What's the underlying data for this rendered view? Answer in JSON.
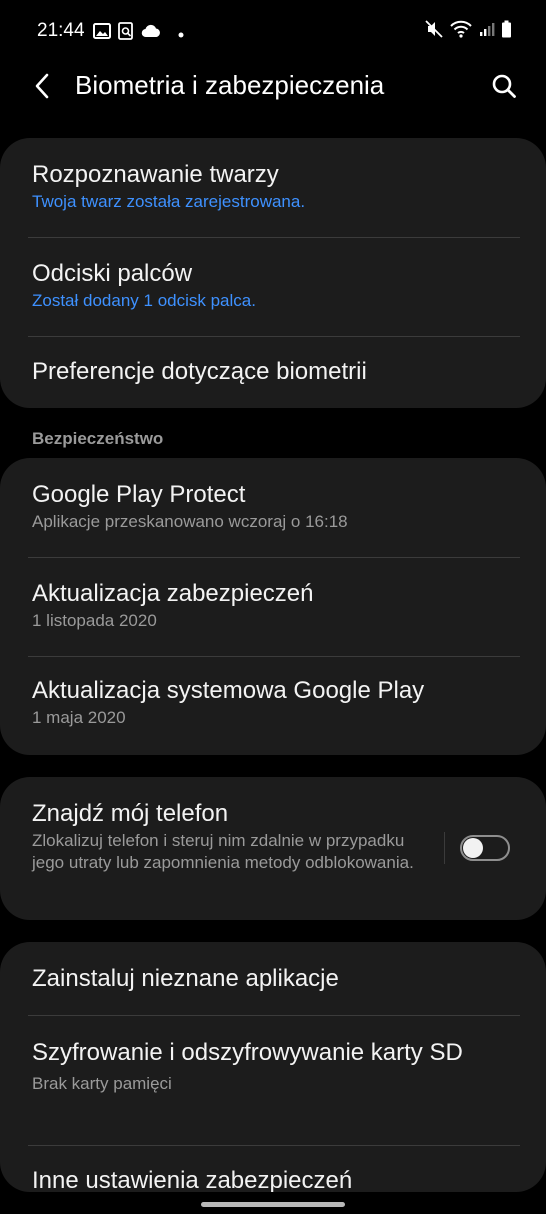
{
  "status_bar": {
    "time": "21:44",
    "left_icons": [
      "gallery-icon",
      "screen-search-icon",
      "cloud-icon",
      "dot-icon"
    ],
    "right_icons": [
      "mute-icon",
      "wifi-icon",
      "signal-icon",
      "battery-icon"
    ]
  },
  "app_bar": {
    "title": "Biometria i zabezpieczenia",
    "back_icon": "back-arrow-icon",
    "search_icon": "search-icon"
  },
  "biometrics": {
    "items": [
      {
        "title": "Rozpoznawanie twarzy",
        "subtitle": "Twoja twarz została zarejestrowana."
      },
      {
        "title": "Odciski palców",
        "subtitle": "Został dodany 1 odcisk palca."
      },
      {
        "title": "Preferencje dotyczące biometrii"
      }
    ]
  },
  "security": {
    "header": "Bezpieczeństwo",
    "items": [
      {
        "title": "Google Play Protect",
        "subtitle": "Aplikacje przeskanowano wczoraj o 16:18"
      },
      {
        "title": "Aktualizacja zabezpieczeń",
        "subtitle": "1 listopada 2020"
      },
      {
        "title": "Aktualizacja systemowa Google Play",
        "subtitle": "1 maja 2020"
      }
    ]
  },
  "find_phone": {
    "title": "Znajdź mój telefon",
    "subtitle": "Zlokalizuj telefon i steruj nim zdalnie w przypadku jego utraty lub zapomnienia metody odblokowania.",
    "toggle_on": false
  },
  "other": {
    "items": [
      {
        "title": "Zainstaluj nieznane aplikacje"
      },
      {
        "title": "Szyfrowanie i odszyfrowywanie karty SD",
        "subtitle": "Brak karty pamięci"
      },
      {
        "title": "Inne ustawienia zabezpieczeń"
      }
    ]
  },
  "colors": {
    "background": "#000000",
    "card": "#1c1c1c",
    "accent_blue": "#3e91ff",
    "secondary_text": "#9a9a9a"
  }
}
